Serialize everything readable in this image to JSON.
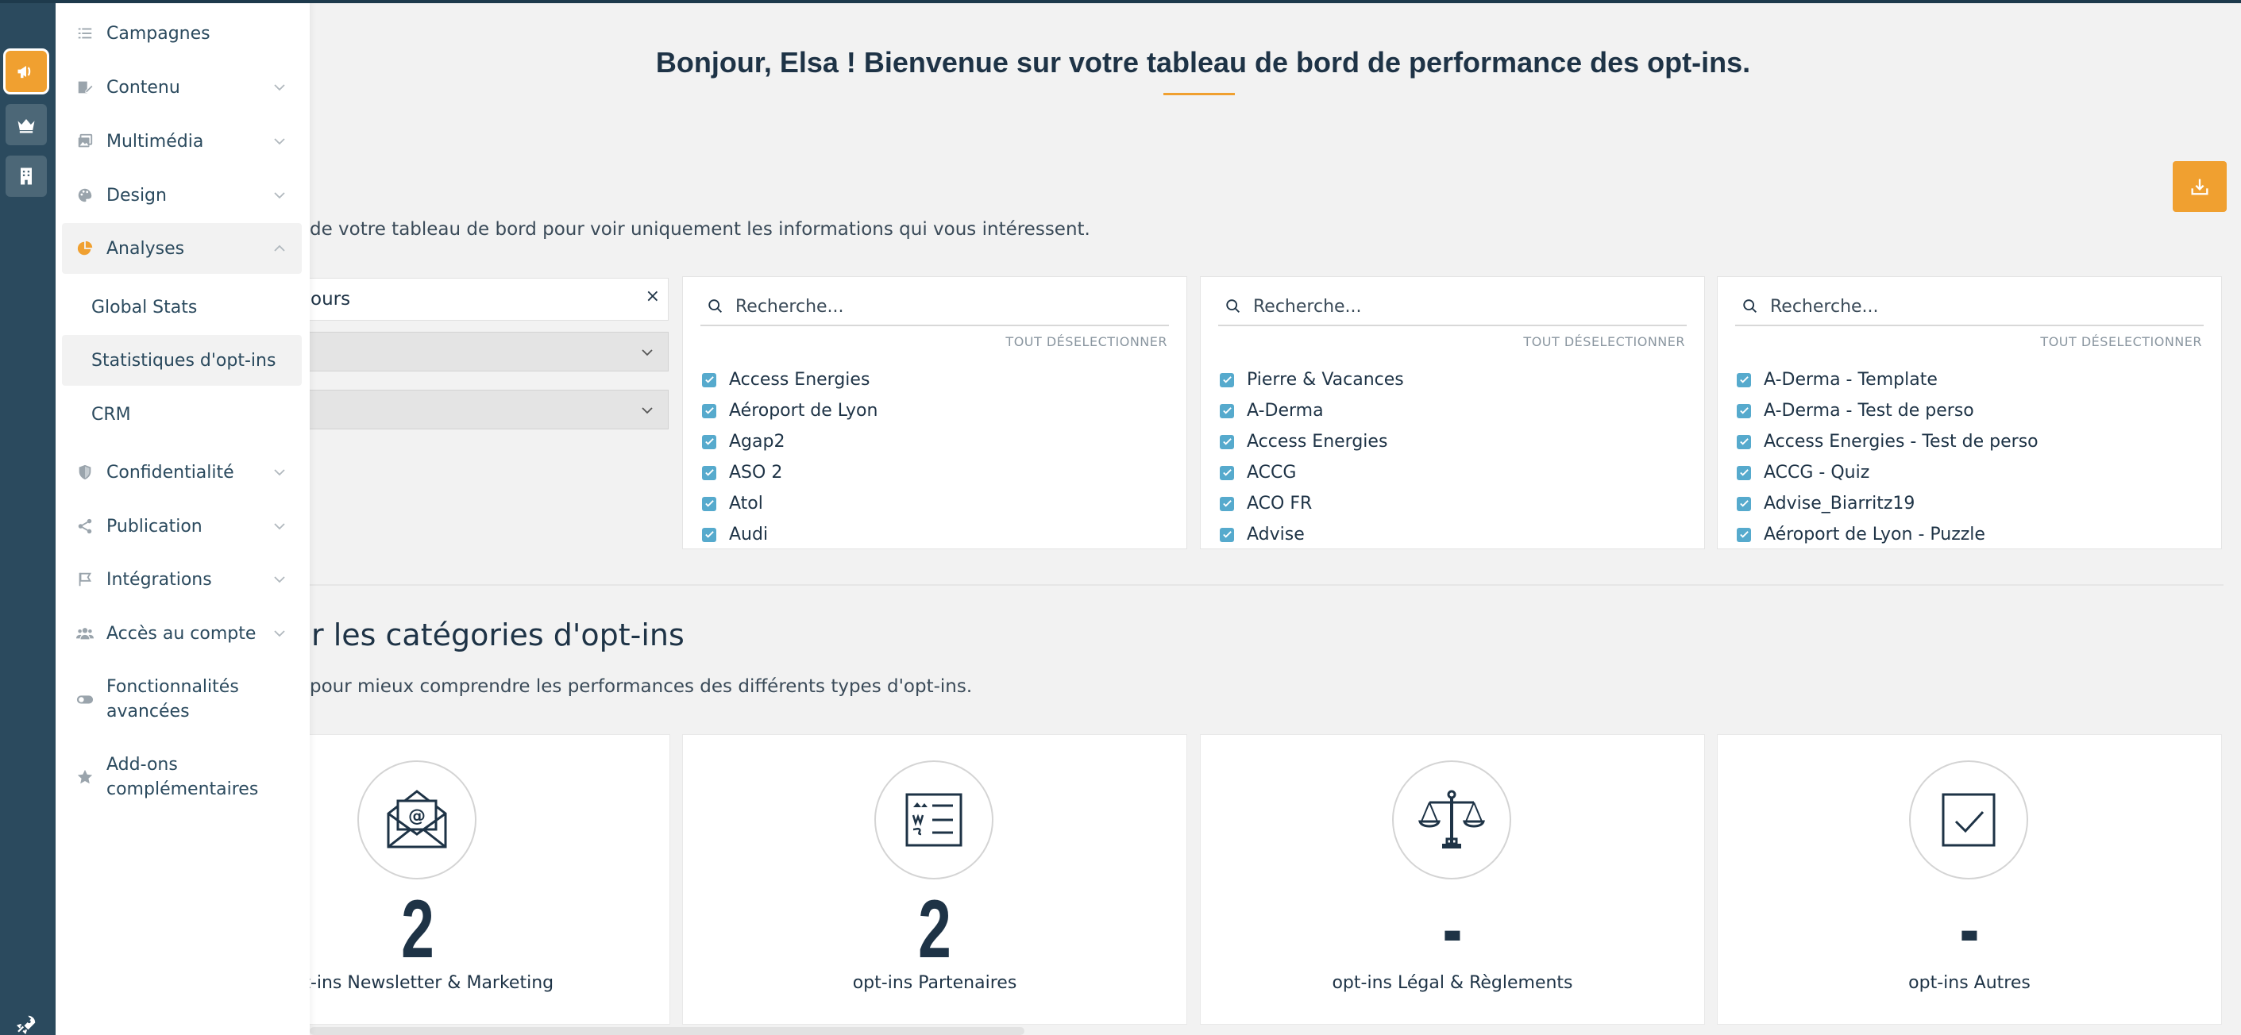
{
  "menu": {
    "items": [
      {
        "label": "Campagnes",
        "icon": "list-icon",
        "has_chevron": false
      },
      {
        "label": "Contenu",
        "icon": "edit-icon",
        "has_chevron": true
      },
      {
        "label": "Multimédia",
        "icon": "images-icon",
        "has_chevron": true
      },
      {
        "label": "Design",
        "icon": "palette-icon",
        "has_chevron": true
      },
      {
        "label": "Analyses",
        "icon": "pie-chart-icon",
        "has_chevron": true,
        "expanded": true
      },
      {
        "label": "Confidentialité",
        "icon": "shield-icon",
        "has_chevron": true
      },
      {
        "label": "Publication",
        "icon": "share-icon",
        "has_chevron": true
      },
      {
        "label": "Intégrations",
        "icon": "flag-icon",
        "has_chevron": true
      },
      {
        "label": "Accès au compte",
        "icon": "users-icon",
        "has_chevron": true
      },
      {
        "label": "Fonctionnalités avancées",
        "icon": "toggle-icon",
        "has_chevron": false
      },
      {
        "label": "Add-ons complémentaires",
        "icon": "star-icon",
        "has_chevron": false
      }
    ],
    "subitems": [
      {
        "label": "Global Stats"
      },
      {
        "label": "Statistiques d'opt-ins",
        "active": true
      },
      {
        "label": "CRM"
      }
    ]
  },
  "header": {
    "welcome": "Bonjour, Elsa ! Bienvenue sur votre tableau de bord de performance des opt-ins."
  },
  "filters": {
    "intro": "de votre tableau de bord pour voir uniquement les informations qui vous intéressent.",
    "date_value": "ours",
    "clear_symbol": "×",
    "cards": [
      {
        "placeholder": "Recherche...",
        "deselect": "TOUT DÉSELECTIONNER",
        "items": [
          "Access Energies",
          "Aéroport de Lyon",
          "Agap2",
          "ASO 2",
          "Atol",
          "Audi"
        ]
      },
      {
        "placeholder": "Recherche...",
        "deselect": "TOUT DÉSELECTIONNER",
        "items": [
          "Pierre & Vacances",
          "A-Derma",
          "Access Energies",
          "ACCG",
          "ACO FR",
          "Advise"
        ]
      },
      {
        "placeholder": "Recherche...",
        "deselect": "TOUT DÉSELECTIONNER",
        "items": [
          "A-Derma - Template",
          "A-Derma - Test de perso",
          "Access Energies - Test de perso",
          "ACCG - Quiz",
          "Advise_Biarritz19",
          "Aéroport de Lyon - Puzzle"
        ]
      }
    ]
  },
  "categories": {
    "title": "r les catégories d'opt-ins",
    "subtitle": "pour mieux comprendre les performances des différents types d'opt-ins.",
    "cards": [
      {
        "value": "2",
        "label": "opt-ins Newsletter & Marketing",
        "icon": "envelope-at-icon"
      },
      {
        "value": "2",
        "label": "opt-ins Partenaires",
        "icon": "contract-icon"
      },
      {
        "value": "-",
        "label": "opt-ins Légal & Règlements",
        "icon": "scales-icon"
      },
      {
        "value": "-",
        "label": "opt-ins Autres",
        "icon": "checkbox-icon"
      }
    ]
  },
  "colors": {
    "accent": "#f0a030",
    "rail": "#2b4a5e",
    "text_dark": "#1e3346",
    "checkbox": "#56aacd"
  }
}
